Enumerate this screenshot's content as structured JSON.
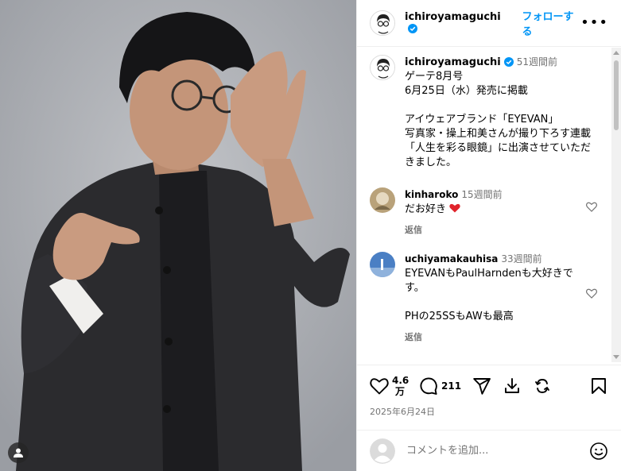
{
  "post": {
    "username": "ichiroyamaguchi",
    "follow_label": "フォローする",
    "more_label": "•••"
  },
  "caption": {
    "username": "ichiroyamaguchi",
    "time": "51週間前",
    "text": "ゲーテ8月号\n6月25日（水）発売に掲載\n\nアイウェアブランド「EYEVAN」\n写真家・操上和美さんが撮り下ろす連載「人生を彩る眼鏡」に出演させていただきました。"
  },
  "comments": [
    {
      "username": "kinharoko",
      "time": "15週間前",
      "text": "だお好き",
      "reply": "返信"
    },
    {
      "username": "uchiyamakauhisa",
      "time": "33週間前",
      "text": "EYEVANもPaulHarndenも大好きです。\n\nPHの25SSもAWも最高",
      "reply": "返信"
    }
  ],
  "actions": {
    "likes_line1": "4.6",
    "likes_line2": "万",
    "comments_count": "211",
    "date": "2025年6月24日"
  },
  "add_comment": {
    "placeholder": "コメントを追加..."
  },
  "colors": {
    "accent": "#0095f6",
    "secondary_text": "#737373",
    "heart_red": "#ed4956"
  },
  "icons": [
    "verified-badge-icon",
    "heart-icon",
    "comment-icon",
    "share-icon",
    "save-icon",
    "repost-icon",
    "bookmark-icon",
    "emoji-icon",
    "tag-user-icon"
  ]
}
